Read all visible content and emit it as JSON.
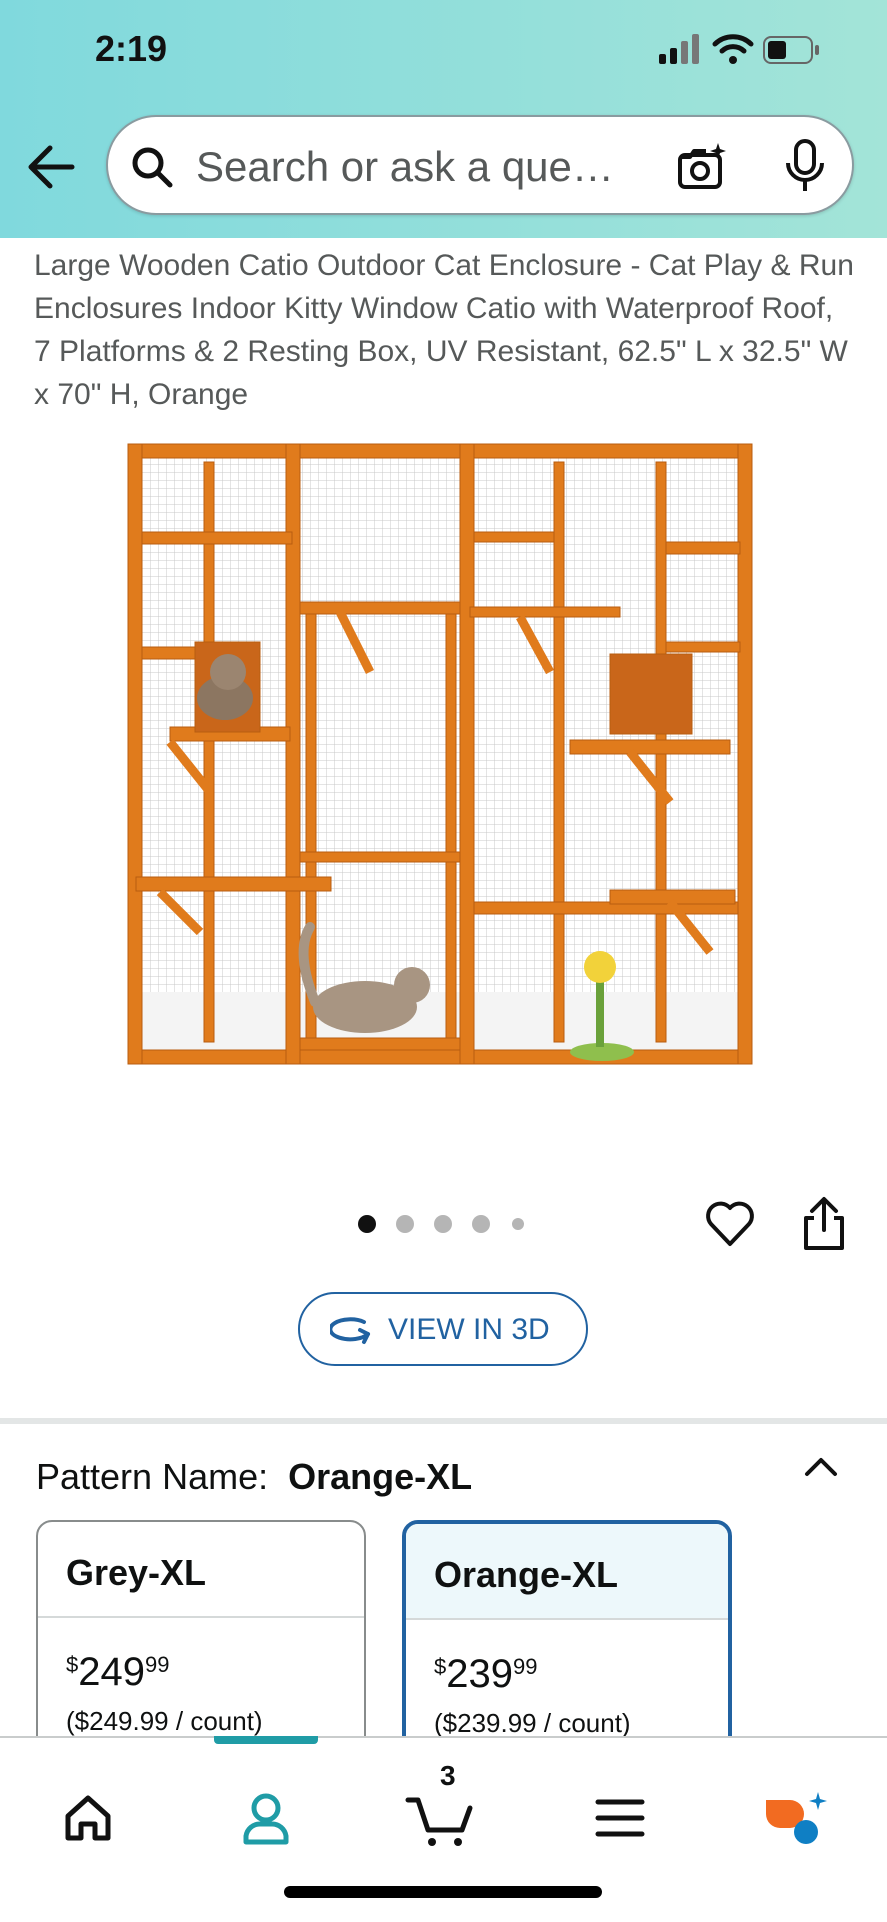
{
  "status_bar": {
    "time": "2:19"
  },
  "search": {
    "placeholder": "Search or ask a que…"
  },
  "product": {
    "title": "Large Wooden Catio Outdoor Cat Enclosure - Cat Play & Run Enclosures Indoor Kitty Window Catio with Waterproof Roof, 7 Platforms & 2 Resting Box, UV Resistant, 62.5\" L x 32.5\" W x 70\" H, Orange",
    "image_alt": "Orange wooden catio with two cats",
    "carousel": {
      "total": 5,
      "active": 1
    }
  },
  "view3d": {
    "label": "VIEW IN 3D"
  },
  "pattern": {
    "label": "Pattern Name:",
    "selected": "Orange-XL",
    "options": [
      {
        "name": "Grey-XL",
        "price_whole": "249",
        "price_frac": "99",
        "price_symbol": "$",
        "unit_price": "($249.99 / count)"
      },
      {
        "name": "Orange-XL",
        "price_whole": "239",
        "price_frac": "99",
        "price_symbol": "$",
        "unit_price": "($239.99 / count)"
      }
    ]
  },
  "tabbar": {
    "cart_count": "3",
    "items": [
      "home-icon",
      "account-icon",
      "cart-icon",
      "menu-icon",
      "rufus-icon"
    ]
  },
  "colors": {
    "accent": "#2162a1",
    "teal": "#1f9ca6",
    "wood": "#e07b1c"
  }
}
